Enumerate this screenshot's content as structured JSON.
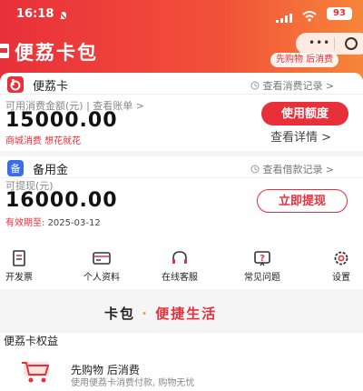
{
  "status": {
    "time": "16:18",
    "battery": "93"
  },
  "brand": {
    "name": "便荔卡包"
  },
  "tagline": "先购物 后消费",
  "card1": {
    "title": "便荔卡",
    "link": "查看消费记录",
    "sublabel": "可用消费金额(元) | 查看账单 >",
    "amount": "15000.00",
    "note": "商城消费 想花就花",
    "button": "使用额度",
    "detail_link": "查看详情 >"
  },
  "card2": {
    "title": "备用金",
    "link": "查看借款记录",
    "sublabel": "可提现(元)",
    "amount": "16000.00",
    "expiry_label": "有效期至:",
    "expiry_date": "2025-03-12",
    "button": "立即提现"
  },
  "shortcuts": [
    {
      "label": "开发票",
      "icon": "invoice-icon"
    },
    {
      "label": "个人资料",
      "icon": "id-card-icon"
    },
    {
      "label": "在线客服",
      "icon": "headset-icon"
    },
    {
      "label": "常见问题",
      "icon": "question-icon"
    },
    {
      "label": "设置",
      "icon": "gear-icon"
    }
  ],
  "banner": {
    "part1": "卡包",
    "dot": "·",
    "part2": "便捷生活"
  },
  "benefits": {
    "title": "便荔卡权益",
    "item_name": "先购物 后消费",
    "item_desc": "使用便荔卡消费付款, 购物无忧"
  },
  "colors": {
    "accent": "#e8303a",
    "gradient_end": "#f6863a"
  }
}
